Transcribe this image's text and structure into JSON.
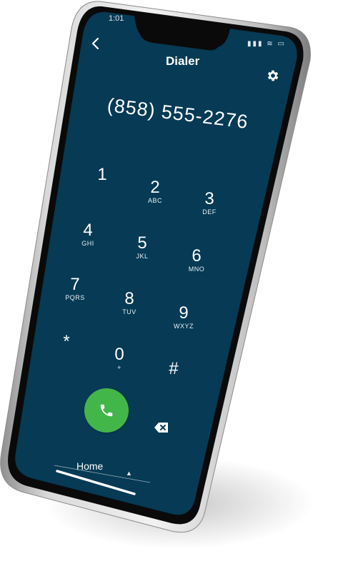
{
  "status_bar": {
    "time": "1:01",
    "icons": [
      "signal-icon",
      "wifi-icon",
      "battery-icon"
    ]
  },
  "header": {
    "title": "Dialer",
    "back_icon": "chevron-left-icon",
    "settings_icon": "gear-icon"
  },
  "dialed_number": "(858) 555-2276",
  "keypad": [
    {
      "digit": "1",
      "letters": ""
    },
    {
      "digit": "2",
      "letters": "ABC"
    },
    {
      "digit": "3",
      "letters": "DEF"
    },
    {
      "digit": "4",
      "letters": "GHI"
    },
    {
      "digit": "5",
      "letters": "JKL"
    },
    {
      "digit": "6",
      "letters": "MNO"
    },
    {
      "digit": "7",
      "letters": "PQRS"
    },
    {
      "digit": "8",
      "letters": "TUV"
    },
    {
      "digit": "9",
      "letters": "WXYZ"
    },
    {
      "digit": "*",
      "letters": ""
    },
    {
      "digit": "0",
      "letters": "+"
    },
    {
      "digit": "#",
      "letters": ""
    }
  ],
  "actions": {
    "call_icon": "phone-icon",
    "delete_icon": "backspace-icon"
  },
  "bottom_tab": {
    "label": "Home",
    "arrow_icon": "caret-up-icon"
  },
  "colors": {
    "screen_background": "#063a55",
    "call_button": "#43b649",
    "frame": "#b9b9b9"
  }
}
